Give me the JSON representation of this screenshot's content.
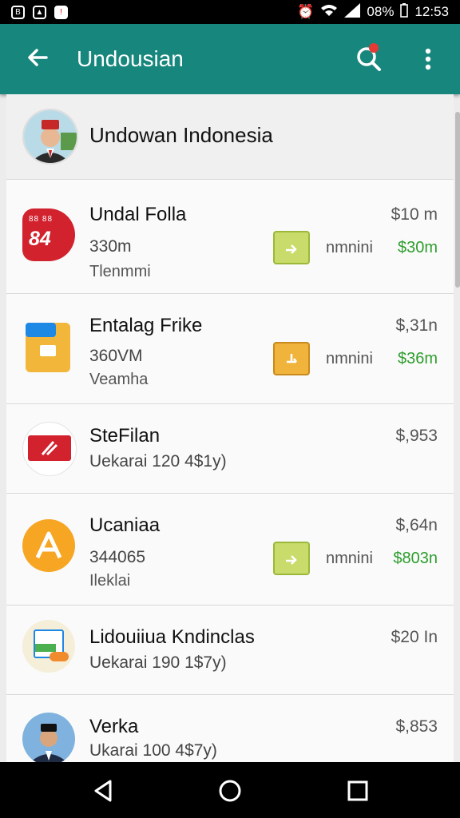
{
  "status": {
    "battery": "08%",
    "time": "12:53"
  },
  "appbar": {
    "title": "Undousian"
  },
  "header": {
    "name": "Undowan Indonesia"
  },
  "rows": [
    {
      "name": "Undal Folla",
      "sub1": "330m",
      "sub2": "Tlenmmi",
      "price": "$10 m",
      "tag_label": "nmnini",
      "change": "$30m",
      "icon_label": "84"
    },
    {
      "name": "Entalag Frike",
      "sub1": "360VM",
      "sub2": "Veamha",
      "price": "$,31n",
      "tag_label": "nmnini",
      "change": "$36m"
    },
    {
      "name": "SteFilan",
      "sub1": "Uekarai 120 4$1y)",
      "price": "$,953"
    },
    {
      "name": "Ucaniaa",
      "sub1": "344065",
      "sub2": "Ileklai",
      "price": "$,64n",
      "tag_label": "nmnini",
      "change": "$803n"
    },
    {
      "name": "Lidouiiua Kndinclas",
      "sub1": "Uekarai 190 1$7y)",
      "price": "$20 In"
    },
    {
      "name": "Verka",
      "sub1": "Ukarai 100 4$7y)",
      "price": "$,853"
    }
  ],
  "colors": {
    "primary": "#17867c",
    "positive": "#2e9d2e",
    "tag_green": "#c9dc6b",
    "tag_orange": "#f0b43c"
  },
  "icons": [
    "back-arrow-icon",
    "search-icon",
    "more-vert-icon",
    "back-triangle-icon",
    "home-circle-icon",
    "recents-square-icon"
  ]
}
